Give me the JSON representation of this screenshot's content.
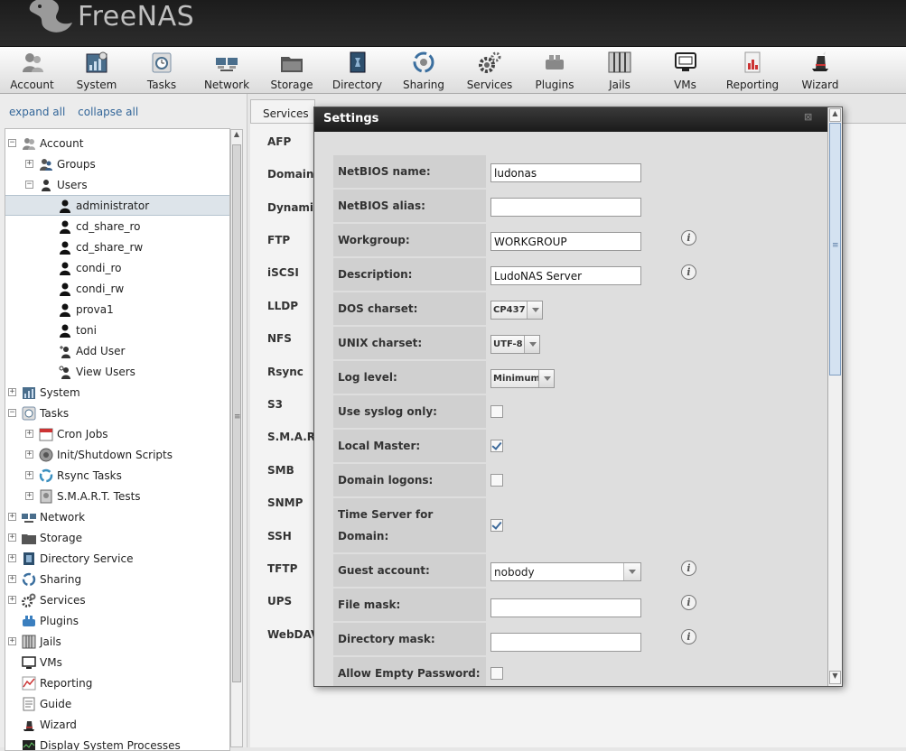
{
  "app": {
    "name": "FreeNAS"
  },
  "toolbar": {
    "items": [
      {
        "label": "Account",
        "icon": "account-icon"
      },
      {
        "label": "System",
        "icon": "system-icon"
      },
      {
        "label": "Tasks",
        "icon": "tasks-icon"
      },
      {
        "label": "Network",
        "icon": "network-icon"
      },
      {
        "label": "Storage",
        "icon": "storage-icon"
      },
      {
        "label": "Directory",
        "icon": "directory-icon"
      },
      {
        "label": "Sharing",
        "icon": "sharing-icon"
      },
      {
        "label": "Services",
        "icon": "services-icon"
      },
      {
        "label": "Plugins",
        "icon": "plugins-icon"
      },
      {
        "label": "Jails",
        "icon": "jails-icon"
      },
      {
        "label": "VMs",
        "icon": "vms-icon"
      },
      {
        "label": "Reporting",
        "icon": "reporting-icon"
      },
      {
        "label": "Wizard",
        "icon": "wizard-icon"
      }
    ]
  },
  "tree_links": {
    "expand_all": "expand all",
    "collapse_all": "collapse all"
  },
  "tree": {
    "account": "Account",
    "groups": "Groups",
    "users": "Users",
    "user_items": [
      "administrator",
      "cd_share_ro",
      "cd_share_rw",
      "condi_ro",
      "condi_rw",
      "prova1",
      "toni"
    ],
    "add_user": "Add User",
    "view_users": "View Users",
    "system": "System",
    "tasks": "Tasks",
    "cron_jobs": "Cron Jobs",
    "init_scripts": "Init/Shutdown Scripts",
    "rsync_tasks": "Rsync Tasks",
    "smart_tests": "S.M.A.R.T. Tests",
    "network": "Network",
    "storage": "Storage",
    "directory_service": "Directory Service",
    "sharing": "Sharing",
    "services": "Services",
    "plugins": "Plugins",
    "jails": "Jails",
    "vms": "VMs",
    "reporting": "Reporting",
    "guide": "Guide",
    "wizard": "Wizard",
    "display_processes": "Display System Processes"
  },
  "services_tab": {
    "label": "Services"
  },
  "services_list": [
    "AFP",
    "Domain",
    "Dynami",
    "FTP",
    "iSCSI",
    "LLDP",
    "NFS",
    "Rsync",
    "S3",
    "S.M.A.R.",
    "SMB",
    "SNMP",
    "SSH",
    "TFTP",
    "UPS",
    "WebDAV"
  ],
  "dialog": {
    "title": "Settings",
    "fields": {
      "netbios_name": {
        "label": "NetBIOS name:",
        "value": "ludonas"
      },
      "netbios_alias": {
        "label": "NetBIOS alias:",
        "value": ""
      },
      "workgroup": {
        "label": "Workgroup:",
        "value": "WORKGROUP"
      },
      "description": {
        "label": "Description:",
        "value": "LudoNAS Server"
      },
      "dos_charset": {
        "label": "DOS charset:",
        "value": "CP437"
      },
      "unix_charset": {
        "label": "UNIX charset:",
        "value": "UTF-8"
      },
      "log_level": {
        "label": "Log level:",
        "value": "Minimum"
      },
      "use_syslog": {
        "label": "Use syslog only:",
        "checked": false
      },
      "local_master": {
        "label": "Local Master:",
        "checked": true
      },
      "domain_logons": {
        "label": "Domain logons:",
        "checked": false
      },
      "time_server_1": "Time Server for",
      "time_server_2": "Domain:",
      "time_server_checked": true,
      "guest_account": {
        "label": "Guest account:",
        "value": "nobody"
      },
      "file_mask": {
        "label": "File mask:",
        "value": ""
      },
      "directory_mask": {
        "label": "Directory mask:",
        "value": ""
      },
      "allow_empty_password": {
        "label": "Allow Empty Password:",
        "checked": false
      }
    }
  },
  "colors": {
    "header_bg": "#1c1c1c",
    "dialog_title_bg": "#2a2a2a",
    "link": "#336699",
    "check": "#3d6a9b"
  }
}
